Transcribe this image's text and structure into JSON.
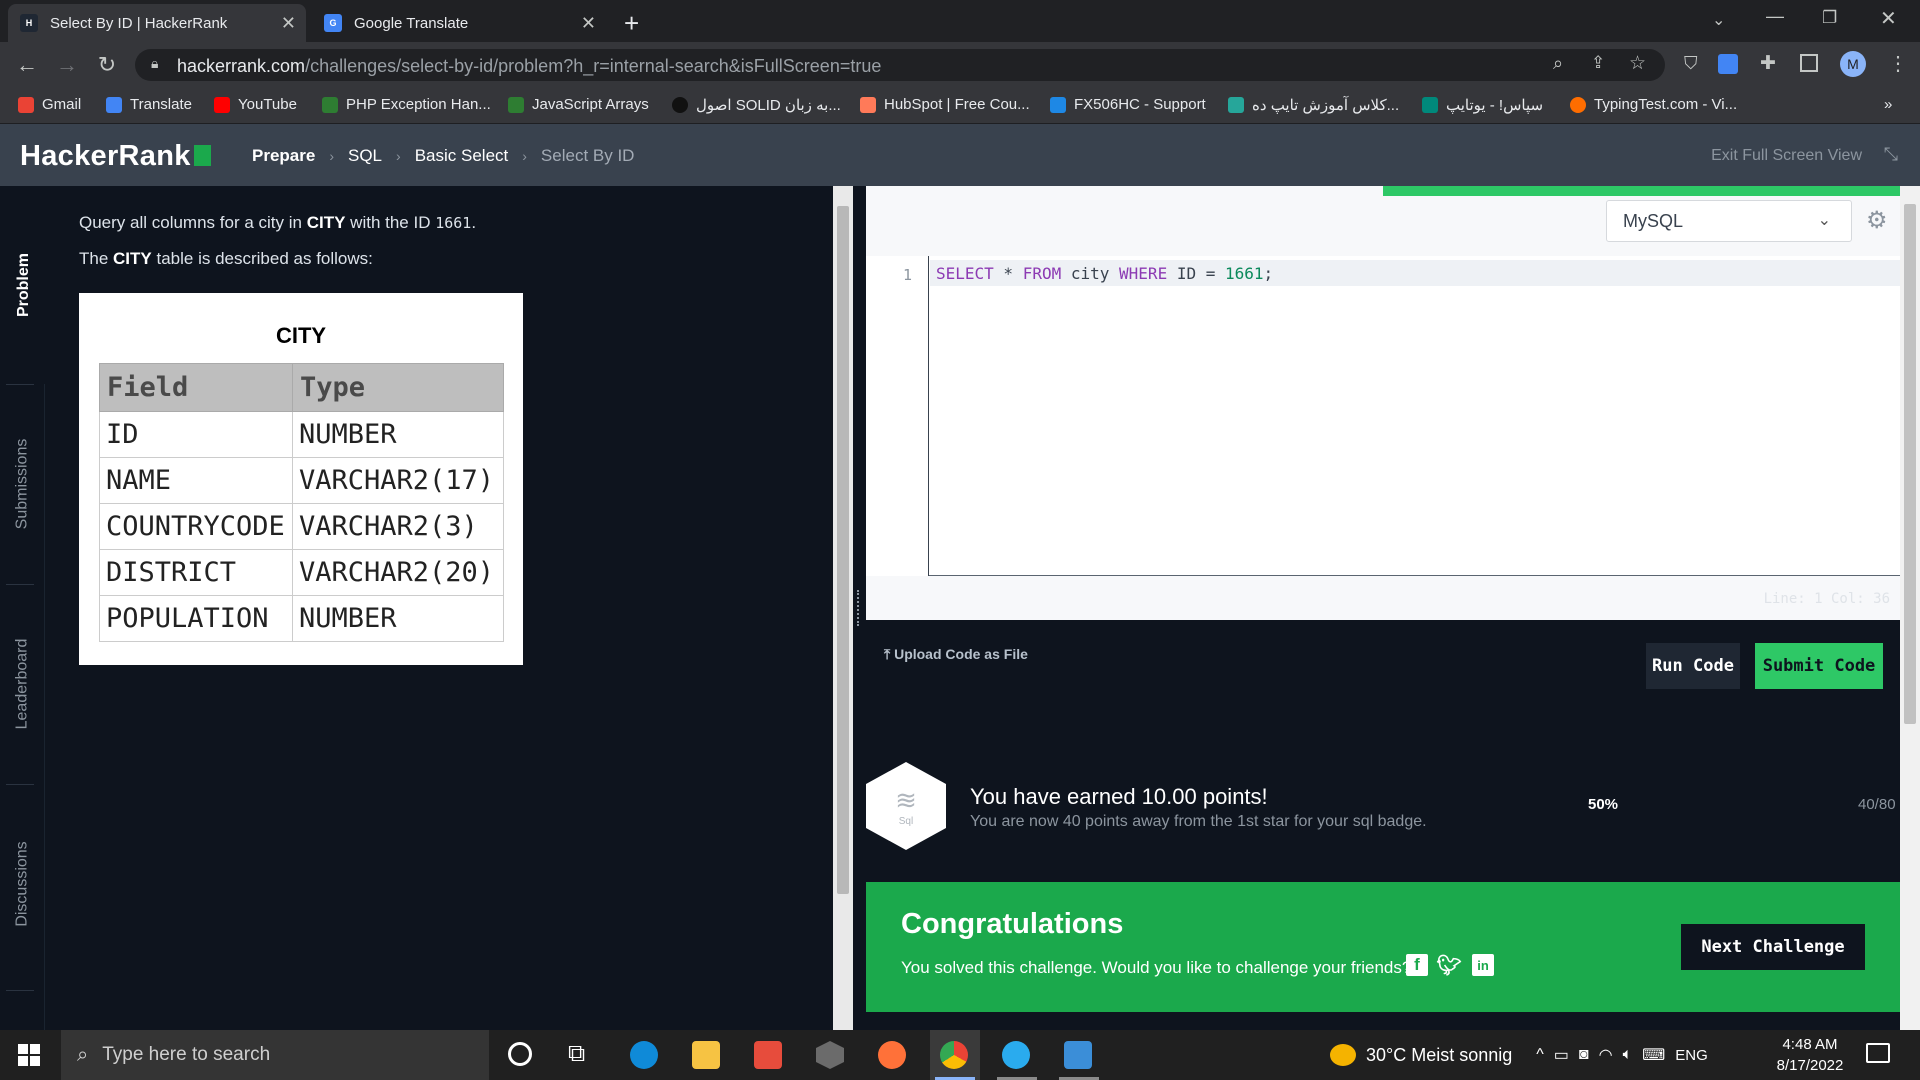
{
  "browser": {
    "tabs": [
      {
        "title": "Select By ID | HackerRank",
        "active": true
      },
      {
        "title": "Google Translate",
        "active": false
      }
    ],
    "url_host": "hackerrank.com",
    "url_path": "/challenges/select-by-id/problem?h_r=internal-search&isFullScreen=true",
    "bookmarks": [
      "Gmail",
      "Translate",
      "YouTube",
      "PHP Exception Han...",
      "JavaScript Arrays",
      "اصول SOLID به زبان...",
      "HubSpot | Free Cou...",
      "FX506HC - Support",
      "کلاس آموزش تایپ ده...",
      "سپاس! - یوتایپ",
      "TypingTest.com - Vi..."
    ],
    "profile_initial": "M"
  },
  "header": {
    "logo": "HackerRank",
    "crumbs": [
      "Prepare",
      "SQL",
      "Basic Select",
      "Select By ID"
    ],
    "exit_full_screen": "Exit Full Screen View"
  },
  "sidebar": {
    "tabs": [
      "Problem",
      "Submissions",
      "Leaderboard",
      "Discussions"
    ]
  },
  "problem": {
    "line1_pre": "Query all columns for a city in ",
    "line1_bold": "CITY",
    "line1_mid": " with the ID ",
    "line1_id": "1661",
    "line1_end": ".",
    "line2_pre": "The ",
    "line2_bold": "CITY",
    "line2_end": " table is described as follows:",
    "table_title": "CITY",
    "table_headers": [
      "Field",
      "Type"
    ],
    "table_rows": [
      [
        "ID",
        "NUMBER"
      ],
      [
        "NAME",
        "VARCHAR2(17)"
      ],
      [
        "COUNTRYCODE",
        "VARCHAR2(3)"
      ],
      [
        "DISTRICT",
        "VARCHAR2(20)"
      ],
      [
        "POPULATION",
        "NUMBER"
      ]
    ]
  },
  "editor": {
    "language": "MySQL",
    "line_number": "1",
    "code_parts": [
      {
        "t": "SELECT",
        "c": "kw"
      },
      {
        "t": " * ",
        "c": ""
      },
      {
        "t": "FROM",
        "c": "kw"
      },
      {
        "t": " city ",
        "c": ""
      },
      {
        "t": "WHERE",
        "c": "kw"
      },
      {
        "t": " ID = ",
        "c": ""
      },
      {
        "t": "1661",
        "c": "num"
      },
      {
        "t": ";",
        "c": ""
      }
    ],
    "cursor_pos": "Line: 1 Col: 36",
    "upload_label": "Upload Code as File",
    "run_label": "Run Code",
    "submit_label": "Submit Code"
  },
  "result": {
    "badge_label": "Sql",
    "earned": "You have earned 10.00 points!",
    "away": "You are now 40 points away from the 1st star for your sql badge.",
    "percent": "50%",
    "points": "40/80",
    "congrats_title": "Congratulations",
    "congrats_msg": "You solved this challenge. Would you like to challenge your friends?",
    "next_label": "Next Challenge"
  },
  "taskbar": {
    "search_placeholder": "Type here to search",
    "weather": "30°C  Meist sonnig",
    "lang": "ENG",
    "time": "4:48 AM",
    "date": "8/17/2022"
  },
  "colors": {
    "accent_green": "#1ba94c",
    "bright_green": "#2ec866",
    "dark_bg": "#0e141e",
    "header_bg": "#39424e"
  }
}
